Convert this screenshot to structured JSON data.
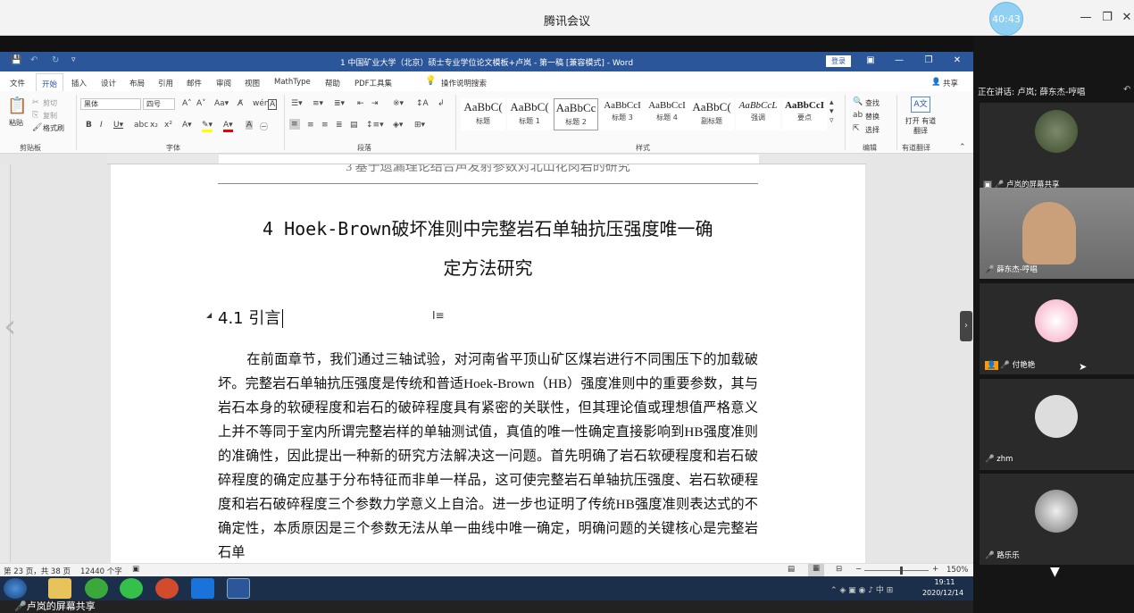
{
  "meeting": {
    "title": "腾讯会议",
    "timer": "40:43"
  },
  "word": {
    "window_title": "1 中国矿业大学（北京）硕士专业学位论文模板+卢岚 - 第一稿 [兼容模式] - Word",
    "login": "登录",
    "tabs": [
      "文件",
      "开始",
      "插入",
      "设计",
      "布局",
      "引用",
      "邮件",
      "审阅",
      "视图",
      "MathType",
      "帮助",
      "PDF工具集"
    ],
    "tell_me": "操作说明搜索",
    "share": "共享",
    "clipboard": {
      "paste": "粘贴",
      "cut": "剪切",
      "copy": "复制",
      "format_painter": "格式刷",
      "label": "剪贴板"
    },
    "font": {
      "name": "黑体",
      "size": "四号",
      "label": "字体"
    },
    "paragraph_label": "段落",
    "styles": [
      {
        "sample": "AaBbC(",
        "name": "标题"
      },
      {
        "sample": "AaBbC(",
        "name": "标题 1"
      },
      {
        "sample": "AaBbCc",
        "name": "标题 2"
      },
      {
        "sample": "AaBbCcI",
        "name": "标题 3"
      },
      {
        "sample": "AaBbCcI",
        "name": "标题 4"
      },
      {
        "sample": "AaBbC(",
        "name": "副标题"
      },
      {
        "sample": "AaBbCcL",
        "name": "强调"
      },
      {
        "sample": "AaBbCcI",
        "name": "要点"
      }
    ],
    "styles_label": "样式",
    "editing": {
      "find": "查找",
      "replace": "替换",
      "select": "选择",
      "label": "编辑"
    },
    "translate": {
      "btn": "打开 有道翻译",
      "label": "有道翻译"
    },
    "doc": {
      "prev_heading": "3 基于遗漏理论结合声发射参数对北山花岗岩的研究",
      "h1_line1": "4 Hoek-Brown破坏准则中完整岩石单轴抗压强度唯一确",
      "h1_line2": "定方法研究",
      "h2": "4.1 引言",
      "body": "在前面章节，我们通过三轴试验，对河南省平顶山矿区煤岩进行不同围压下的加载破坏。完整岩石单轴抗压强度是传统和普适Hoek-Brown（HB）强度准则中的重要参数，其与岩石本身的软硬程度和岩石的破碎程度具有紧密的关联性，但其理论值或理想值严格意义上并不等同于室内所谓完整岩样的单轴测试值，真值的唯一性确定直接影响到HB强度准则的准确性，因此提出一种新的研究方法解决这一问题。首先明确了岩石软硬程度和岩石破碎程度的确定应基于分布特征而非单一样品，这可使完整岩石单轴抗压强度、岩石软硬程度和岩石破碎程度三个参数力学意义上自洽。进一步也证明了传统HB强度准则表达式的不确定性，本质原因是三个参数无法从单一曲线中唯一确定，明确问题的关键核心是完整岩石单"
    },
    "status": {
      "page": "第 23 页，共 38 页",
      "words": "12440 个字",
      "zoom": "150%"
    }
  },
  "taskbar": {
    "time": "19:11",
    "date": "2020/12/14"
  },
  "share_label": "卢岚的屏幕共享",
  "panel": {
    "speaking": "正在讲话: 卢岚; 薛东杰-哼唱",
    "tiles": [
      {
        "name": "卢岚的屏幕共享"
      },
      {
        "name": "薛东杰-哼唱"
      },
      {
        "name": "付艳艳"
      },
      {
        "name": "zhm"
      },
      {
        "name": "路乐乐"
      }
    ]
  }
}
